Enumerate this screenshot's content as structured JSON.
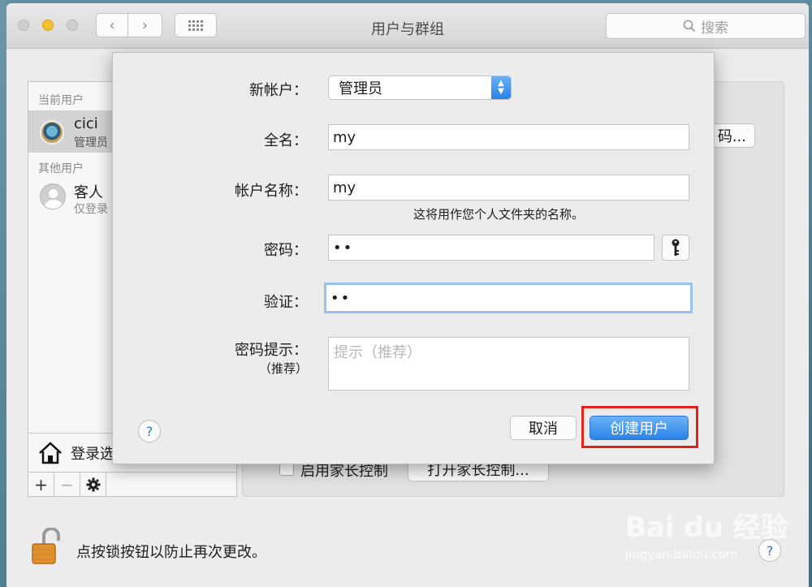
{
  "window": {
    "title": "用户与群组",
    "search_placeholder": "搜索"
  },
  "sidebar": {
    "current_header": "当前用户",
    "other_header": "其他用户",
    "current_user": {
      "name": "cici",
      "role": "管理员"
    },
    "other_user": {
      "name": "客人",
      "role": "仅登录"
    },
    "login_options": "登录选项"
  },
  "pane": {
    "change_password_fragment": "码...",
    "parental_checkbox_label": "启用家长控制",
    "parental_button": "打开家长控制..."
  },
  "footer": {
    "lock_text": "点按锁按钮以防止再次更改。"
  },
  "sheet": {
    "new_account_label": "新帐户：",
    "new_account_value": "管理员",
    "full_name_label": "全名：",
    "full_name_value": "my",
    "account_name_label": "帐户名称：",
    "account_name_value": "my",
    "account_name_note": "这将用作您个人文件夹的名称。",
    "password_label": "密码：",
    "password_value": "••",
    "verify_label": "验证：",
    "verify_value": "••",
    "hint_label": "密码提示：",
    "hint_sub_label": "（推荐）",
    "hint_placeholder": "提示（推荐）",
    "cancel_button": "取消",
    "create_button": "创建用户"
  },
  "watermark": {
    "brand": "Bai du 经验",
    "url": "jingyan.baidu.com"
  },
  "colors": {
    "accent": "#2a82e8",
    "highlight_box": "#e2231a"
  }
}
